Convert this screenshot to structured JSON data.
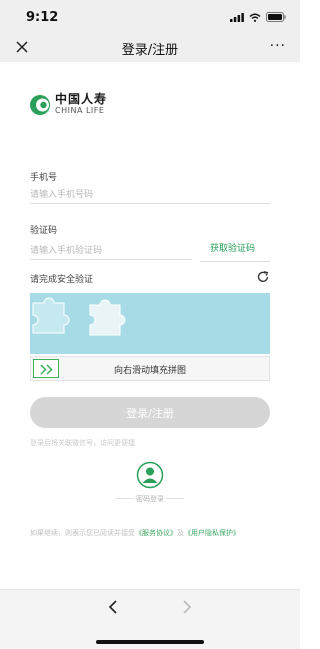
{
  "status_bar": {
    "time": "9:12"
  },
  "nav": {
    "title": "登录/注册",
    "more": "···"
  },
  "logo": {
    "cn": "中国人寿",
    "en": "CHINA LIFE"
  },
  "phone": {
    "label": "手机号",
    "placeholder": "请输入手机号码"
  },
  "code": {
    "label": "验证码",
    "placeholder": "请输入手机验证码",
    "get_code": "获取验证码"
  },
  "security": {
    "label": "请完成安全验证",
    "slider_text": "向右滑动填充拼图"
  },
  "login_button": "登录/注册",
  "hint": "登录后将关联微信号，访问更便捷",
  "password_login": "密码登录",
  "agreement": {
    "prefix": "如果继续，则表示您已阅读并接受",
    "service": "《服务协议》",
    "and": "及",
    "privacy": "《用户隐私保护》"
  },
  "colors": {
    "brand_green": "#2aa05a",
    "puzzle_bg": "#a7dbe6",
    "button_disabled": "#d6d6d6"
  }
}
